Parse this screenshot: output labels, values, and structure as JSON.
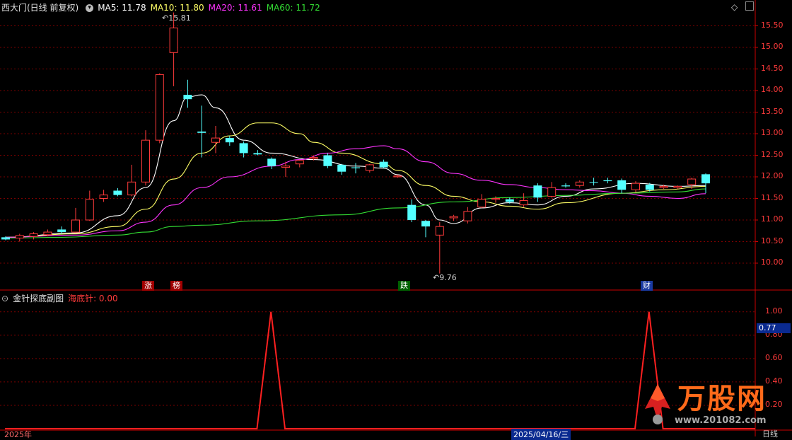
{
  "header": {
    "stock_name": "西大门(日线 前复权)",
    "ma5_label": "MA5: 11.78",
    "ma10_label": "MA10: 11.80",
    "ma20_label": "MA20: 11.61",
    "ma60_label": "MA60: 11.72",
    "menu_icon": "circle-menu-icon",
    "corner_icon": "diamond-icon"
  },
  "sub_header": {
    "indicator_name": "金针探底副图",
    "series_label": "海底针: 0.00"
  },
  "colors": {
    "up": "#ff3b3b",
    "down": "#54ffff",
    "ma5": "#ffffff",
    "ma10": "#ffff66",
    "ma20": "#ff33ff",
    "ma60": "#33dd33",
    "grid": "#7a0000",
    "indicator": "#ff2020"
  },
  "price_axis": {
    "ticks": [
      "15.50",
      "15.00",
      "14.50",
      "14.00",
      "13.50",
      "13.00",
      "12.50",
      "12.00",
      "11.50",
      "11.00",
      "10.50",
      "10.00"
    ]
  },
  "indicator_axis": {
    "ticks": [
      "1.00",
      "0.80",
      "0.60",
      "0.40",
      "0.20"
    ],
    "current": "0.77"
  },
  "annotations": {
    "high": "15.81",
    "low": "9.76",
    "tags": [
      "涨",
      "榜",
      "跌",
      "财"
    ]
  },
  "bottom_bar": {
    "left_text": "2025年",
    "date_text": "2025/04/16/三",
    "right_text": "日线"
  },
  "watermark": {
    "brand": "万股网",
    "site": "www.201082.com"
  },
  "chart_data": [
    {
      "type": "candlestick",
      "title": "西大门(日线 前复权)",
      "ylim": [
        9.55,
        15.85
      ],
      "candles": [
        {
          "o": 10.55,
          "h": 10.62,
          "l": 10.53,
          "c": 10.6,
          "dir": "down"
        },
        {
          "o": 10.58,
          "h": 10.68,
          "l": 10.5,
          "c": 10.64,
          "dir": "up"
        },
        {
          "o": 10.62,
          "h": 10.72,
          "l": 10.55,
          "c": 10.68,
          "dir": "up"
        },
        {
          "o": 10.66,
          "h": 10.78,
          "l": 10.62,
          "c": 10.72,
          "dir": "up"
        },
        {
          "o": 10.78,
          "h": 10.85,
          "l": 10.68,
          "c": 10.72,
          "dir": "down"
        },
        {
          "o": 10.72,
          "h": 11.28,
          "l": 10.7,
          "c": 11.0,
          "dir": "up"
        },
        {
          "o": 11.0,
          "h": 11.68,
          "l": 10.98,
          "c": 11.48,
          "dir": "up"
        },
        {
          "o": 11.5,
          "h": 11.7,
          "l": 11.42,
          "c": 11.58,
          "dir": "up"
        },
        {
          "o": 11.68,
          "h": 11.74,
          "l": 11.55,
          "c": 11.58,
          "dir": "down"
        },
        {
          "o": 11.58,
          "h": 12.28,
          "l": 11.55,
          "c": 11.88,
          "dir": "up"
        },
        {
          "o": 11.88,
          "h": 13.08,
          "l": 11.8,
          "c": 12.85,
          "dir": "up"
        },
        {
          "o": 12.85,
          "h": 14.4,
          "l": 12.78,
          "c": 14.37,
          "dir": "up"
        },
        {
          "o": 14.88,
          "h": 15.81,
          "l": 14.1,
          "c": 15.45,
          "dir": "up"
        },
        {
          "o": 13.9,
          "h": 14.25,
          "l": 13.6,
          "c": 13.8,
          "dir": "down"
        },
        {
          "o": 13.02,
          "h": 13.65,
          "l": 12.45,
          "c": 13.05,
          "dir": "down"
        },
        {
          "o": 12.8,
          "h": 13.18,
          "l": 12.55,
          "c": 12.9,
          "dir": "up"
        },
        {
          "o": 12.9,
          "h": 12.95,
          "l": 12.72,
          "c": 12.8,
          "dir": "down"
        },
        {
          "o": 12.78,
          "h": 12.82,
          "l": 12.45,
          "c": 12.55,
          "dir": "down"
        },
        {
          "o": 12.55,
          "h": 12.62,
          "l": 12.5,
          "c": 12.52,
          "dir": "down"
        },
        {
          "o": 12.42,
          "h": 12.45,
          "l": 12.18,
          "c": 12.25,
          "dir": "down"
        },
        {
          "o": 12.22,
          "h": 12.35,
          "l": 12.0,
          "c": 12.25,
          "dir": "up"
        },
        {
          "o": 12.3,
          "h": 12.4,
          "l": 12.22,
          "c": 12.38,
          "dir": "up"
        },
        {
          "o": 12.42,
          "h": 12.5,
          "l": 12.38,
          "c": 12.45,
          "dir": "up"
        },
        {
          "o": 12.5,
          "h": 12.55,
          "l": 12.2,
          "c": 12.25,
          "dir": "down"
        },
        {
          "o": 12.28,
          "h": 12.3,
          "l": 12.05,
          "c": 12.12,
          "dir": "down"
        },
        {
          "o": 12.22,
          "h": 12.32,
          "l": 12.08,
          "c": 12.2,
          "dir": "down"
        },
        {
          "o": 12.15,
          "h": 12.3,
          "l": 12.1,
          "c": 12.28,
          "dir": "up"
        },
        {
          "o": 12.35,
          "h": 12.4,
          "l": 12.2,
          "c": 12.22,
          "dir": "down"
        },
        {
          "o": 12.02,
          "h": 12.05,
          "l": 11.98,
          "c": 12.0,
          "dir": "up"
        },
        {
          "o": 11.35,
          "h": 11.48,
          "l": 10.95,
          "c": 11.0,
          "dir": "down"
        },
        {
          "o": 10.98,
          "h": 11.0,
          "l": 10.6,
          "c": 10.85,
          "dir": "down"
        },
        {
          "o": 10.65,
          "h": 10.95,
          "l": 9.76,
          "c": 10.85,
          "dir": "up"
        },
        {
          "o": 11.05,
          "h": 11.12,
          "l": 10.98,
          "c": 11.08,
          "dir": "up"
        },
        {
          "o": 10.98,
          "h": 11.3,
          "l": 10.92,
          "c": 11.2,
          "dir": "up"
        },
        {
          "o": 11.3,
          "h": 11.6,
          "l": 11.28,
          "c": 11.48,
          "dir": "up"
        },
        {
          "o": 11.48,
          "h": 11.55,
          "l": 11.4,
          "c": 11.5,
          "dir": "up"
        },
        {
          "o": 11.48,
          "h": 11.52,
          "l": 11.38,
          "c": 11.42,
          "dir": "down"
        },
        {
          "o": 11.45,
          "h": 11.62,
          "l": 11.3,
          "c": 11.35,
          "dir": "up"
        },
        {
          "o": 11.52,
          "h": 11.85,
          "l": 11.42,
          "c": 11.8,
          "dir": "down"
        },
        {
          "o": 11.55,
          "h": 11.88,
          "l": 11.52,
          "c": 11.75,
          "dir": "up"
        },
        {
          "o": 11.8,
          "h": 11.85,
          "l": 11.75,
          "c": 11.78,
          "dir": "down"
        },
        {
          "o": 11.88,
          "h": 11.92,
          "l": 11.75,
          "c": 11.8,
          "dir": "up"
        },
        {
          "o": 11.88,
          "h": 11.98,
          "l": 11.8,
          "c": 11.88,
          "dir": "down"
        },
        {
          "o": 11.92,
          "h": 11.98,
          "l": 11.85,
          "c": 11.9,
          "dir": "down"
        },
        {
          "o": 11.92,
          "h": 11.96,
          "l": 11.62,
          "c": 11.7,
          "dir": "down"
        },
        {
          "o": 11.7,
          "h": 11.9,
          "l": 11.65,
          "c": 11.85,
          "dir": "up"
        },
        {
          "o": 11.82,
          "h": 11.86,
          "l": 11.66,
          "c": 11.7,
          "dir": "down"
        },
        {
          "o": 11.78,
          "h": 11.82,
          "l": 11.72,
          "c": 11.75,
          "dir": "up"
        },
        {
          "o": 11.75,
          "h": 11.8,
          "l": 11.72,
          "c": 11.78,
          "dir": "up"
        },
        {
          "o": 11.82,
          "h": 11.98,
          "l": 11.72,
          "c": 11.95,
          "dir": "up"
        },
        {
          "o": 12.06,
          "h": 12.08,
          "l": 11.62,
          "c": 11.85,
          "dir": "down"
        }
      ],
      "ma": {
        "ma5": [
          [
            0,
            10.6
          ],
          [
            5,
            10.7
          ],
          [
            8,
            11.1
          ],
          [
            10,
            11.75
          ],
          [
            12,
            13.3
          ],
          [
            13,
            13.85
          ],
          [
            14,
            13.9
          ],
          [
            15,
            13.6
          ],
          [
            17,
            12.85
          ],
          [
            19,
            12.55
          ],
          [
            22,
            12.4
          ],
          [
            25,
            12.25
          ],
          [
            27,
            12.2
          ],
          [
            28,
            12.05
          ],
          [
            30,
            11.35
          ],
          [
            31,
            11.0
          ],
          [
            32,
            10.92
          ],
          [
            34,
            11.28
          ],
          [
            36,
            11.4
          ],
          [
            38,
            11.35
          ],
          [
            40,
            11.55
          ],
          [
            42,
            11.72
          ],
          [
            45,
            11.85
          ],
          [
            48,
            11.78
          ],
          [
            50,
            11.8
          ]
        ],
        "ma10": [
          [
            0,
            10.6
          ],
          [
            5,
            10.68
          ],
          [
            8,
            10.85
          ],
          [
            10,
            11.25
          ],
          [
            12,
            11.95
          ],
          [
            14,
            12.55
          ],
          [
            16,
            12.95
          ],
          [
            18,
            13.25
          ],
          [
            19,
            13.25
          ],
          [
            21,
            13.0
          ],
          [
            22,
            12.8
          ],
          [
            24,
            12.55
          ],
          [
            27,
            12.3
          ],
          [
            28,
            12.15
          ],
          [
            30,
            11.8
          ],
          [
            32,
            11.55
          ],
          [
            34,
            11.42
          ],
          [
            36,
            11.32
          ],
          [
            38,
            11.25
          ],
          [
            40,
            11.4
          ],
          [
            44,
            11.62
          ],
          [
            47,
            11.7
          ],
          [
            50,
            11.78
          ]
        ],
        "ma20": [
          [
            0,
            10.6
          ],
          [
            5,
            10.65
          ],
          [
            8,
            10.75
          ],
          [
            10,
            10.95
          ],
          [
            12,
            11.35
          ],
          [
            14,
            11.75
          ],
          [
            16,
            12.0
          ],
          [
            19,
            12.25
          ],
          [
            21,
            12.4
          ],
          [
            23,
            12.55
          ],
          [
            25,
            12.65
          ],
          [
            27,
            12.72
          ],
          [
            28,
            12.65
          ],
          [
            30,
            12.35
          ],
          [
            32,
            12.08
          ],
          [
            34,
            11.92
          ],
          [
            36,
            11.82
          ],
          [
            38,
            11.75
          ],
          [
            40,
            11.7
          ],
          [
            42,
            11.68
          ],
          [
            44,
            11.62
          ],
          [
            46,
            11.55
          ],
          [
            48,
            11.5
          ],
          [
            50,
            11.61
          ]
        ],
        "ma60": [
          [
            0,
            10.58
          ],
          [
            4,
            10.6
          ],
          [
            8,
            10.65
          ],
          [
            10,
            10.72
          ],
          [
            12,
            10.85
          ],
          [
            14,
            10.88
          ],
          [
            18,
            10.98
          ],
          [
            24,
            11.12
          ],
          [
            28,
            11.28
          ],
          [
            32,
            11.42
          ],
          [
            36,
            11.52
          ],
          [
            40,
            11.57
          ],
          [
            44,
            11.62
          ],
          [
            48,
            11.65
          ],
          [
            50,
            11.72
          ]
        ]
      }
    },
    {
      "type": "line",
      "title": "金针探底副图",
      "series": [
        {
          "name": "海底针",
          "values": [
            0,
            0,
            0,
            0,
            0,
            0,
            0,
            0,
            0,
            0,
            0,
            0,
            0,
            0,
            0,
            0,
            0,
            0,
            0,
            1,
            0,
            0,
            0,
            0,
            0,
            0,
            0,
            0,
            0,
            0,
            0,
            0,
            0,
            0,
            0,
            0,
            0,
            0,
            0,
            0,
            0,
            0,
            0,
            0,
            0,
            0,
            1,
            0,
            0,
            0,
            0
          ]
        }
      ],
      "ylim": [
        0,
        1.15
      ]
    }
  ]
}
